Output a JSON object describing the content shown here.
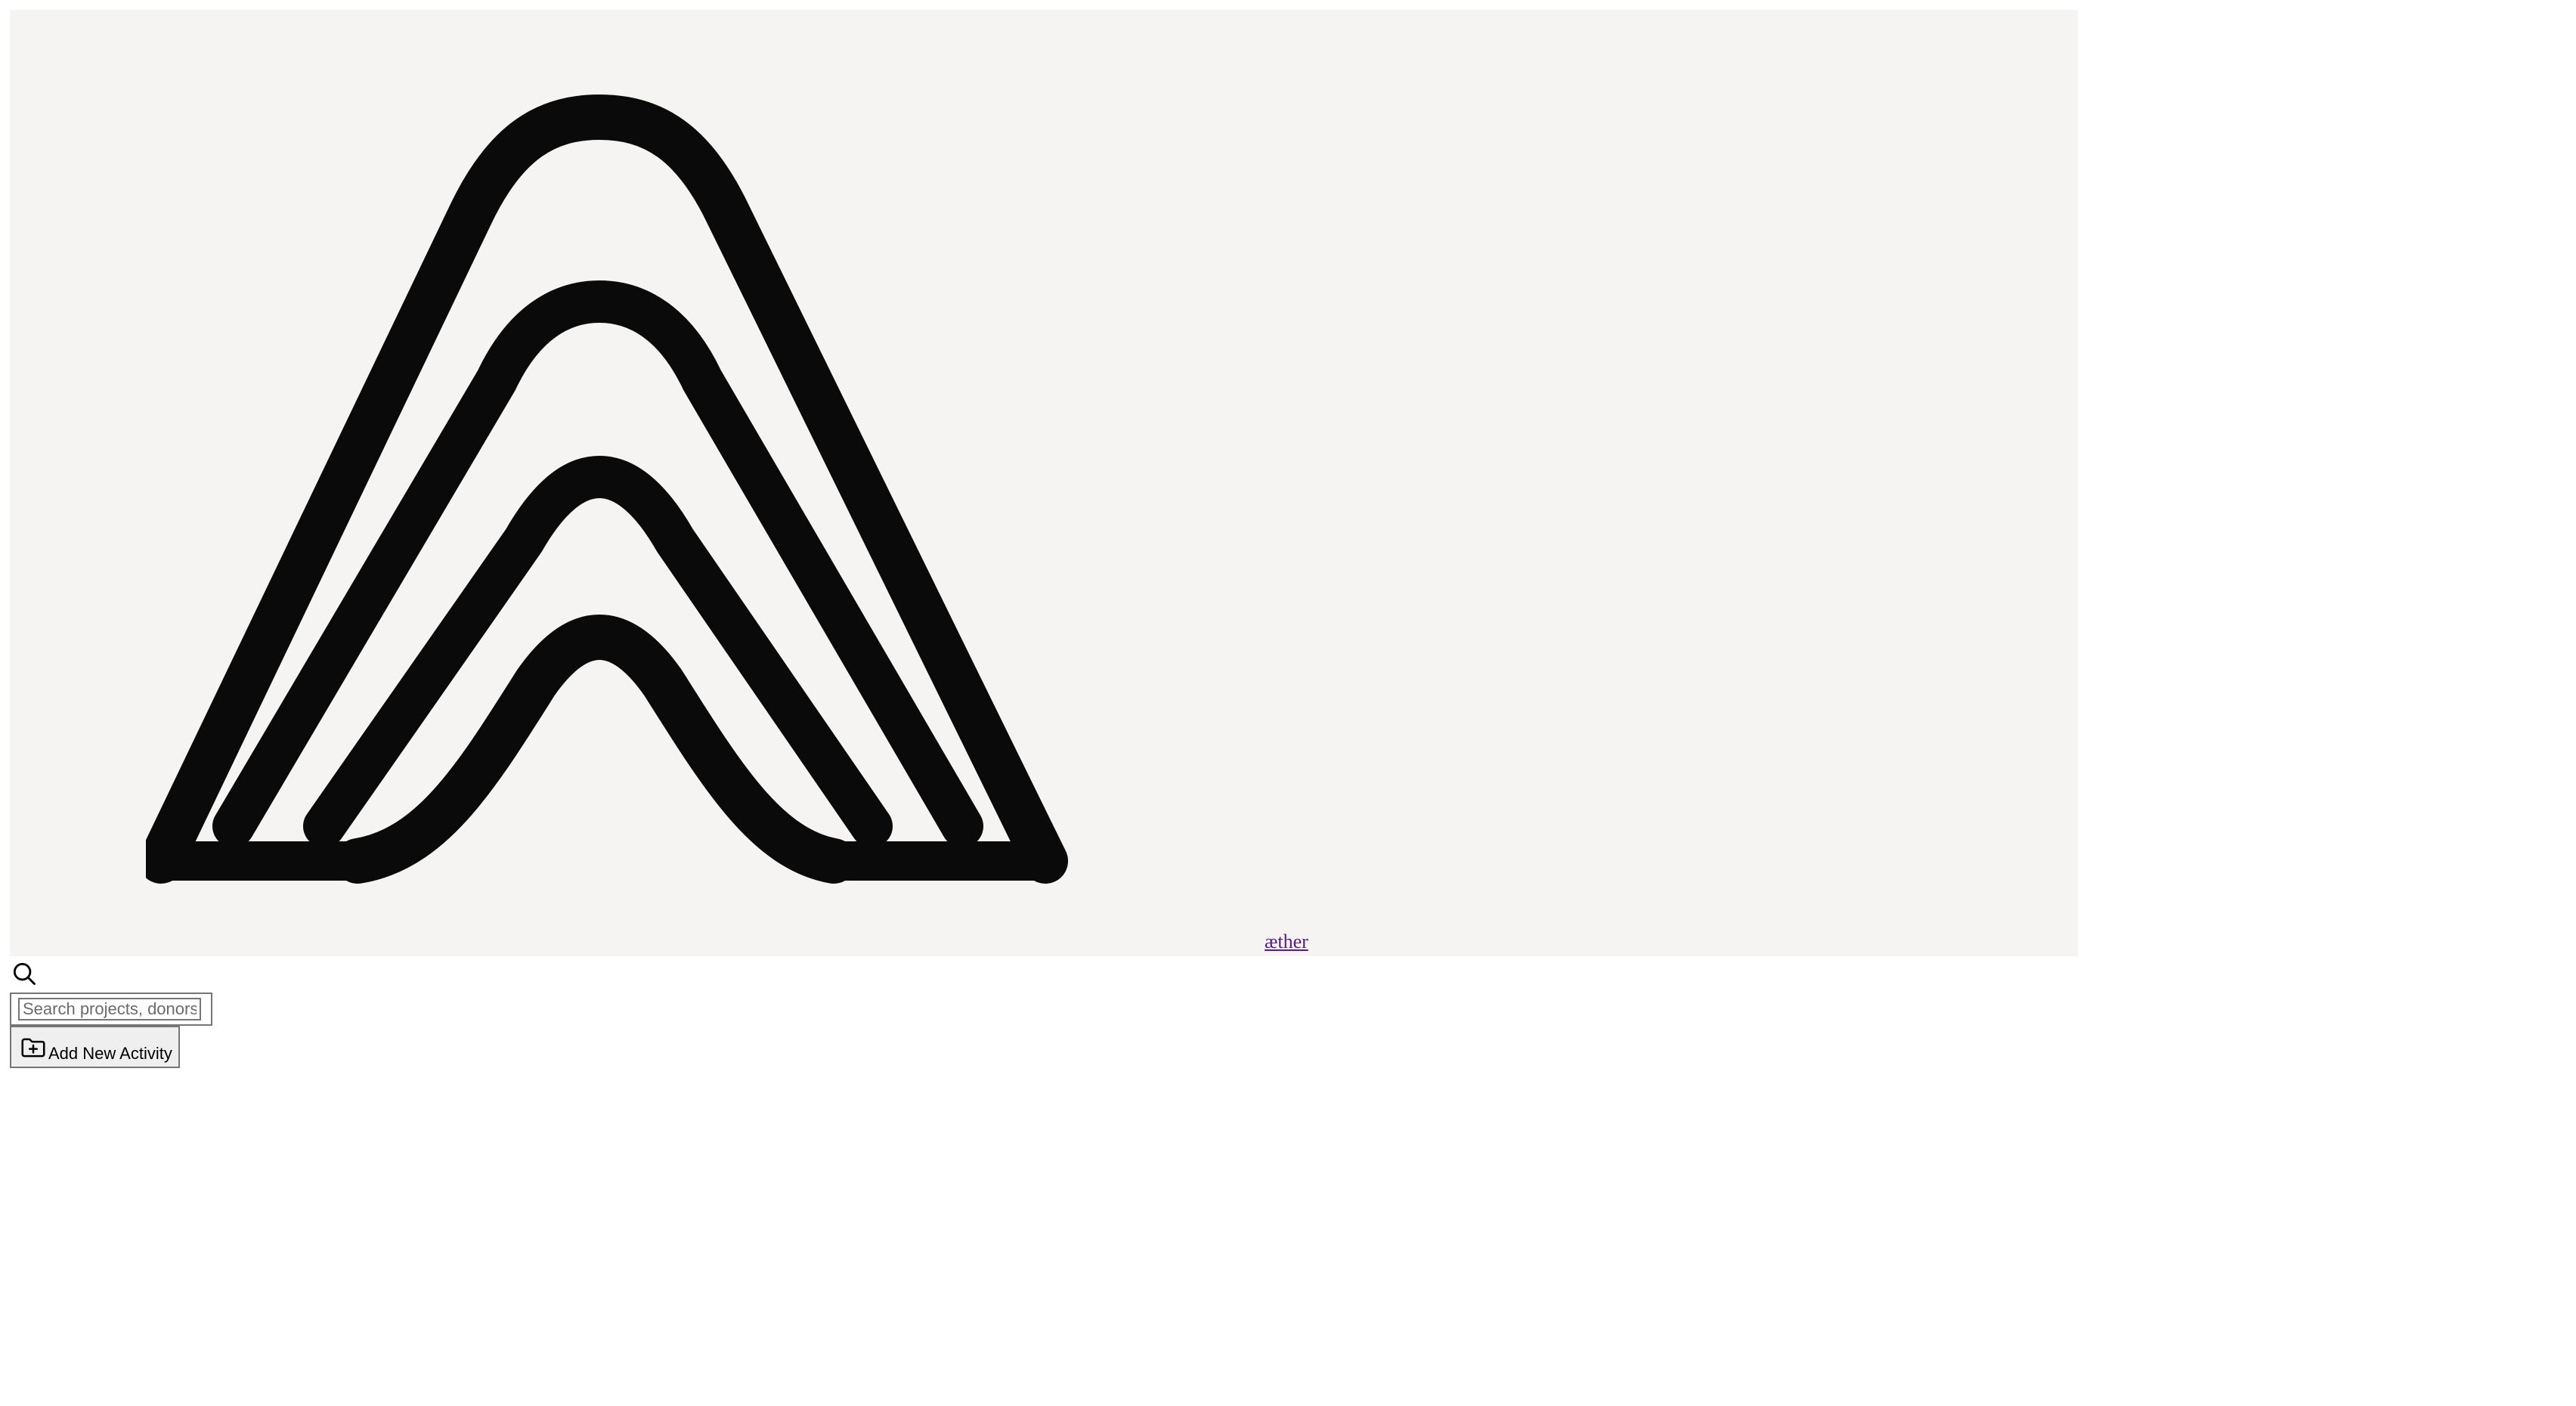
{
  "header": {
    "brand_name": "æther",
    "logo_icon": "aether-arch-logo"
  },
  "search": {
    "icon": "search-icon",
    "placeholder": "Search projects, donors, ..."
  },
  "actions": {
    "add_activity_label": "Add New Activity",
    "add_activity_icon": "folder-plus-icon"
  },
  "colors": {
    "logo_background": "#f5f4f2",
    "link": "#551a8b",
    "logo_stroke": "#0a0a0a"
  }
}
